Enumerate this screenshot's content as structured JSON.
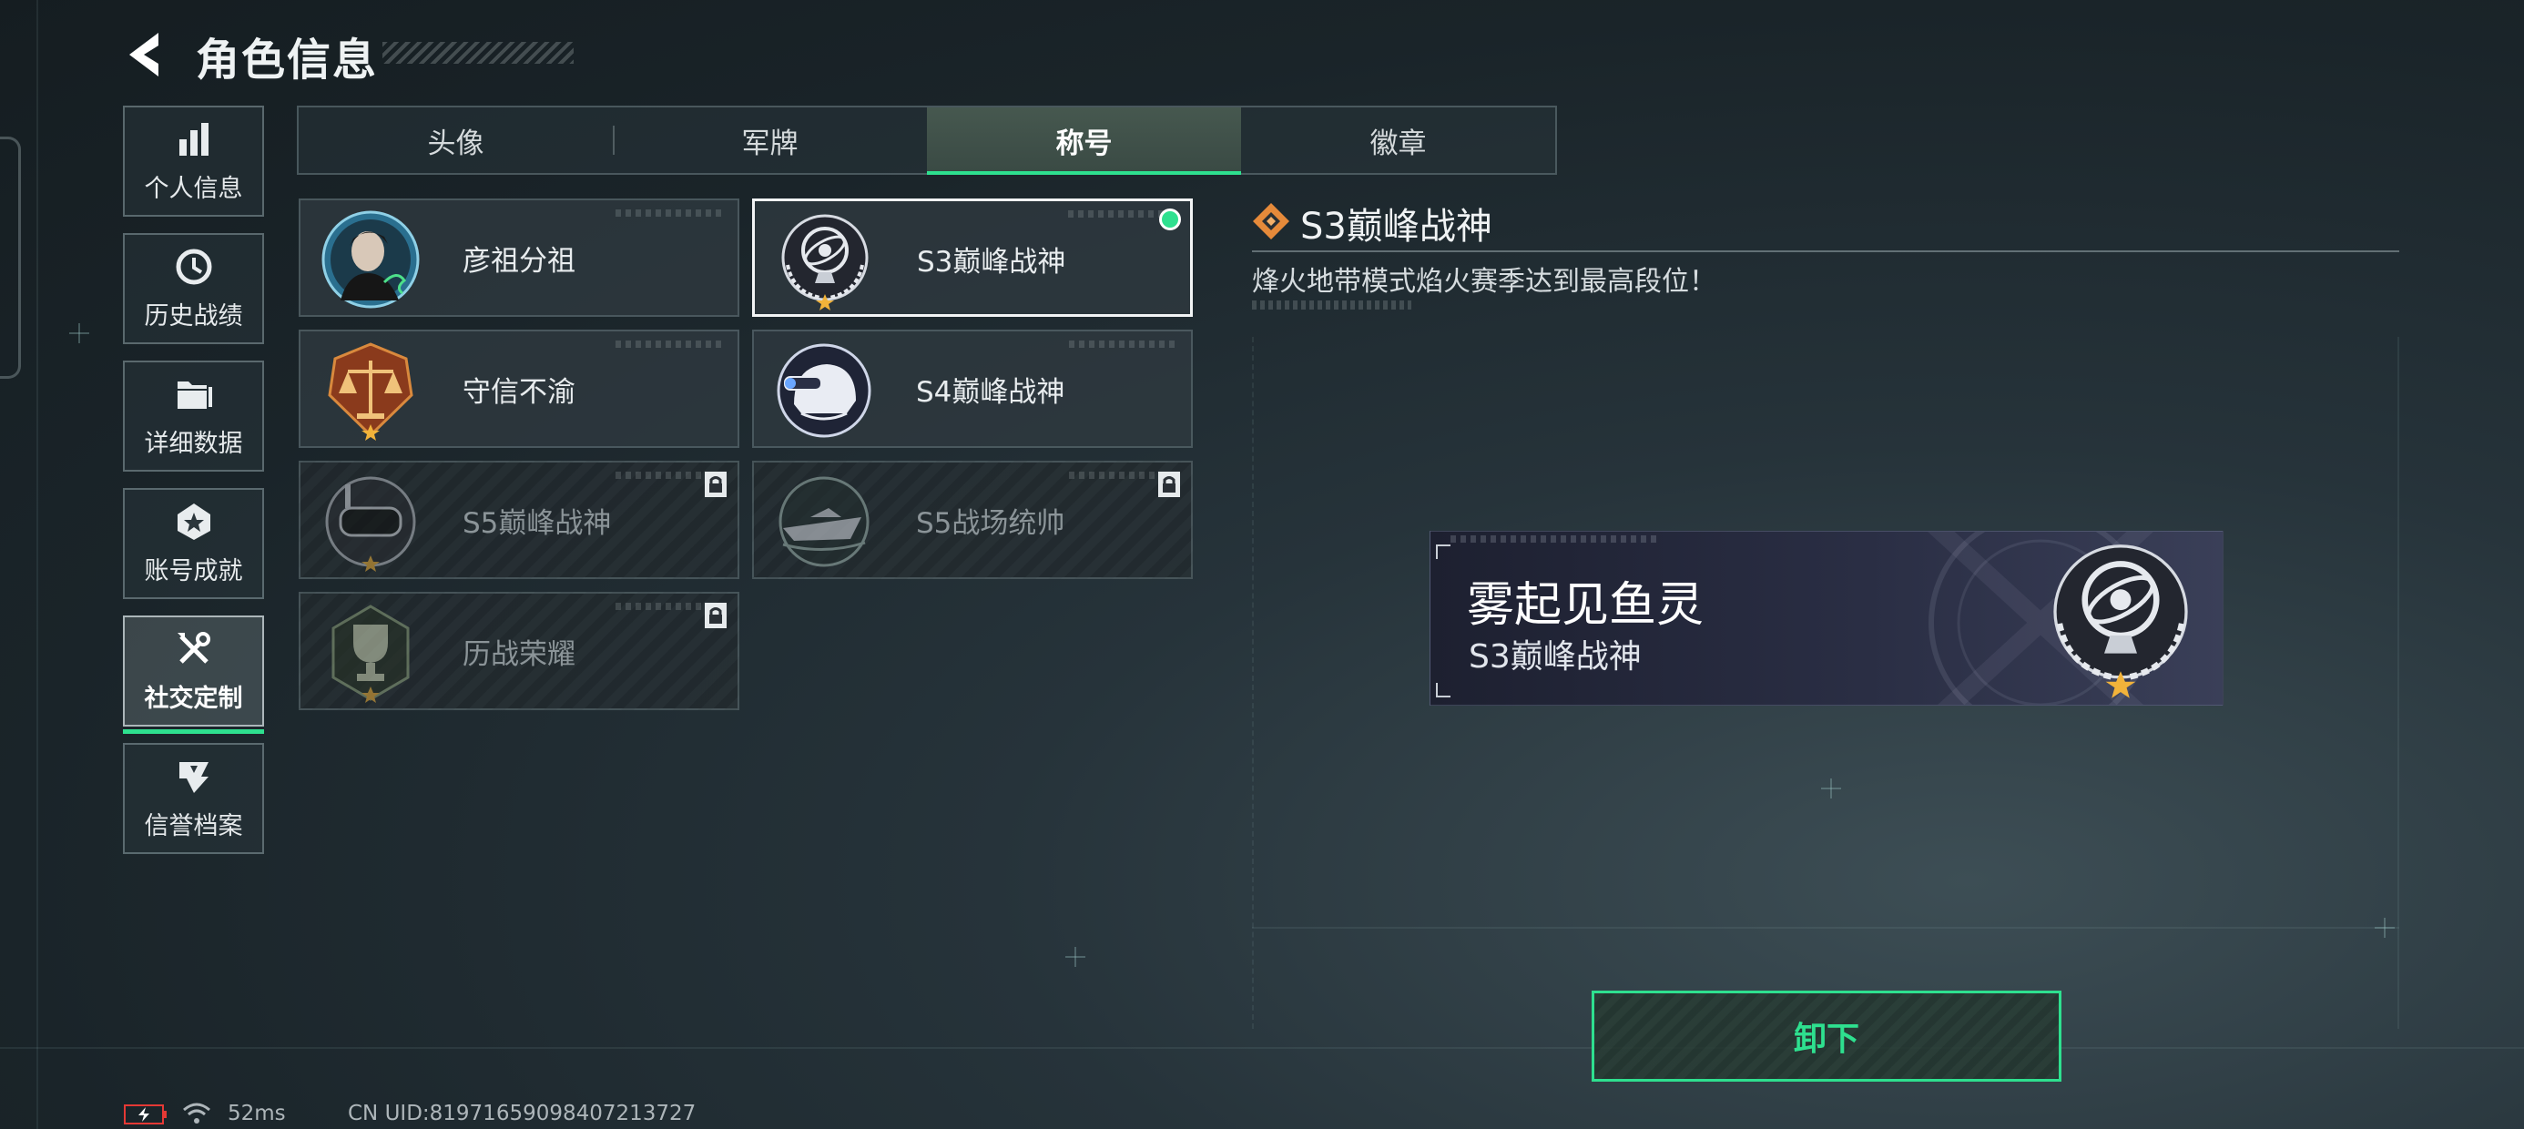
{
  "header": {
    "title": "角色信息"
  },
  "sidebar": {
    "items": [
      {
        "label": "个人信息",
        "icon": "bar-chart-icon",
        "active": false
      },
      {
        "label": "历史战绩",
        "icon": "clock-icon",
        "active": false
      },
      {
        "label": "详细数据",
        "icon": "folder-icon",
        "active": false
      },
      {
        "label": "账号成就",
        "icon": "achievement-icon",
        "active": false
      },
      {
        "label": "社交定制",
        "icon": "tools-icon",
        "active": true
      },
      {
        "label": "信誉档案",
        "icon": "reputation-icon",
        "active": false
      }
    ]
  },
  "tabs": [
    {
      "label": "头像",
      "active": false
    },
    {
      "label": "军牌",
      "active": false
    },
    {
      "label": "称号",
      "active": true
    },
    {
      "label": "徽章",
      "active": false
    }
  ],
  "titles": [
    {
      "label": "彦祖分祖",
      "emblem": "portrait-emblem-icon",
      "locked": false,
      "selected": false
    },
    {
      "label": "S3巅峰战神",
      "emblem": "armillary-sphere-emblem-icon",
      "locked": false,
      "selected": true,
      "equipped": true
    },
    {
      "label": "守信不渝",
      "emblem": "scales-emblem-icon",
      "locked": false,
      "selected": false
    },
    {
      "label": "S4巅峰战神",
      "emblem": "helmet-emblem-icon",
      "locked": false,
      "selected": false
    },
    {
      "label": "S5巅峰战神",
      "emblem": "diving-mask-emblem-icon",
      "locked": true,
      "selected": false
    },
    {
      "label": "S5战场统帅",
      "emblem": "boat-emblem-icon",
      "locked": true,
      "selected": false
    },
    {
      "label": "历战荣耀",
      "emblem": "trophy-emblem-icon",
      "locked": true,
      "selected": false
    }
  ],
  "detail": {
    "title": "S3巅峰战神",
    "description": "烽火地带模式焰火赛季达到最高段位！"
  },
  "preview": {
    "player_name": "雾起见鱼灵",
    "title": "S3巅峰战神"
  },
  "actions": {
    "unequip_label": "卸下"
  },
  "status": {
    "ping": "52ms",
    "uid": "CN UID:81971659098407213727"
  },
  "colors": {
    "accent": "#2ee08f",
    "panel": "#303a40",
    "background": "#1a2429"
  }
}
